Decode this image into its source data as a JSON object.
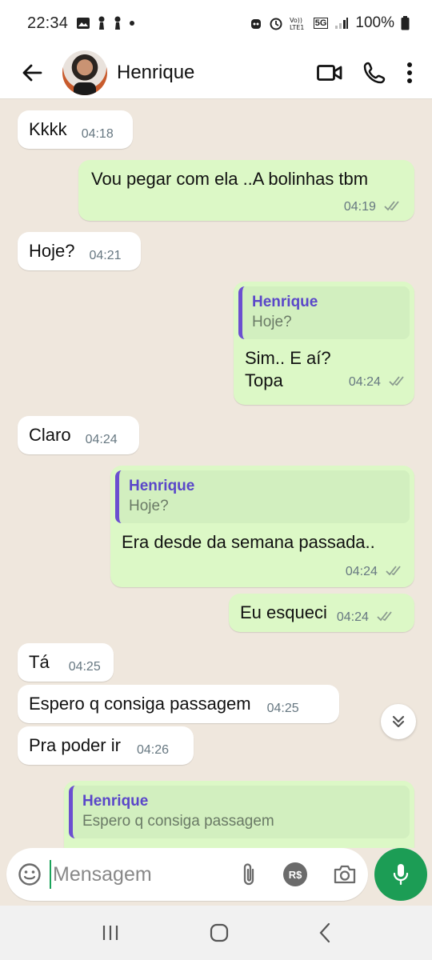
{
  "status": {
    "time": "22:34",
    "battery": "100%",
    "network": "5G"
  },
  "header": {
    "contact_name": "Henrique"
  },
  "messages": [
    {
      "dir": "in",
      "text": "Kkkk",
      "time": "04:18"
    },
    {
      "dir": "out",
      "text": "Vou pegar com ela ..A bolinhas tbm",
      "time": "04:19"
    },
    {
      "dir": "in",
      "text": "Hoje?",
      "time": "04:21"
    },
    {
      "dir": "out",
      "quote_name": "Henrique",
      "quote_text": "Hoje?",
      "text_line1": "Sim.. E aí?",
      "text_line2": "Topa",
      "time": "04:24"
    },
    {
      "dir": "in",
      "text": "Claro",
      "time": "04:24"
    },
    {
      "dir": "out",
      "quote_name": "Henrique",
      "quote_text": "Hoje?",
      "text": "Era desde da semana passada..",
      "time": "04:24"
    },
    {
      "dir": "out",
      "text": "Eu esqueci",
      "time": "04:24"
    },
    {
      "dir": "in",
      "text": "Tá",
      "time": "04:25"
    },
    {
      "dir": "in",
      "text": "Espero q consiga passagem",
      "time": "04:25"
    },
    {
      "dir": "in",
      "text": "Pra poder ir",
      "time": "04:26"
    },
    {
      "dir": "out",
      "quote_name": "Henrique",
      "quote_text": "Espero q consiga passagem"
    }
  ],
  "input": {
    "placeholder": "Mensagem",
    "currency_label": "R$"
  },
  "colors": {
    "accent": "#1c9d55",
    "outgoing": "#dcf8c6",
    "quote_bar": "#6b4fd0"
  }
}
